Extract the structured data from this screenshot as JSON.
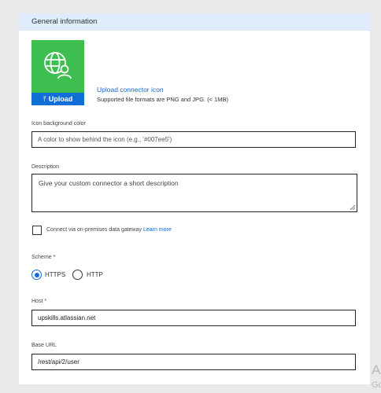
{
  "section": {
    "title": "General information"
  },
  "icon": {
    "name": "globe-person-icon",
    "upload_label": "Upload",
    "background": "#3fbf4f"
  },
  "upload": {
    "link": "Upload connector icon",
    "hint": "Supported file formats are PNG and JPG. (< 1MB)"
  },
  "icon_bg": {
    "label": "Icon background color",
    "placeholder": "A color to show behind the icon (e.g., '#007ee5')"
  },
  "description": {
    "label": "Description",
    "placeholder": "Give your custom connector a short description"
  },
  "gateway": {
    "label": "Connect via on-premises data gateway",
    "link": "Learn more"
  },
  "scheme": {
    "label": "Scheme *",
    "options": [
      "HTTPS",
      "HTTP"
    ],
    "selected": "HTTPS"
  },
  "host": {
    "label": "Host *",
    "value": "upskills.atlassian.net"
  },
  "base_url": {
    "label": "Base URL",
    "value": "/rest/api/2/user"
  },
  "side": {
    "line1": "A",
    "line2": "Go"
  }
}
